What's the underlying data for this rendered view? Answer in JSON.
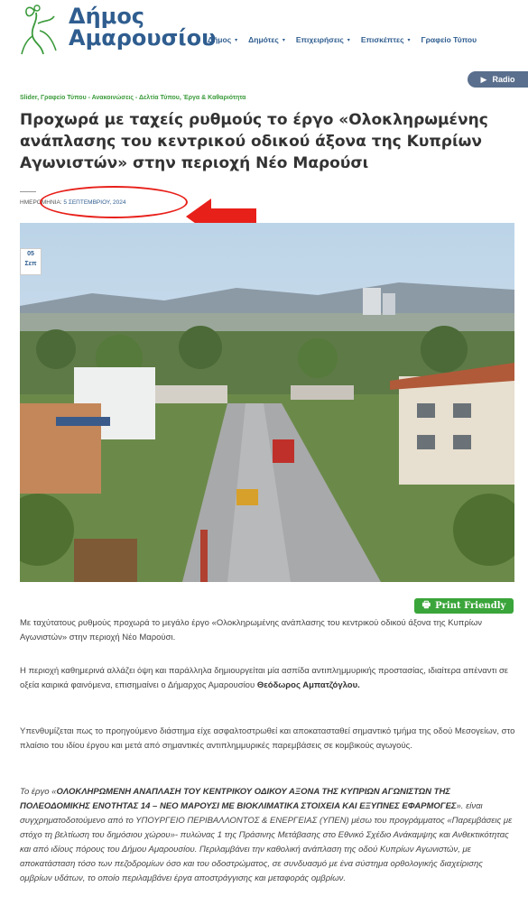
{
  "header": {
    "logo_line1": "Δήμος",
    "logo_line2": "Αμαρουσίου",
    "nav": [
      {
        "label": "Δήμος"
      },
      {
        "label": "Δημότες"
      },
      {
        "label": "Επιχειρήσεις"
      },
      {
        "label": "Επισκέπτες"
      },
      {
        "label": "Γραφείο Τύπου"
      }
    ],
    "radio_label": "Radio"
  },
  "article": {
    "categories": "Slider, Γραφείο Τύπου - Ανακοινώσεις - Δελτία Τύπου, Έργα & Καθαριότητα",
    "title": "Προχωρά με ταχείς ρυθμούς το έργο «Ολοκληρωμένης ανάπλασης του κεντρικού οδικού άξονα της Κυπρίων Αγωνιστών» στην περιοχή Νέο Μαρούσι",
    "date_label": "ΗΜΕΡΟΜΗΝΙΑ:",
    "date_value": "5 ΣΕΠΤΕΜΒΡΙΟΥ, 2024",
    "badge_day": "05",
    "badge_month": "Σεπ",
    "print_label": "Print Friendly",
    "p1": "Με ταχύτατους ρυθμούς προχωρά το μεγάλο έργο «Ολοκληρωμένης ανάπλασης του κεντρικού οδικού άξονα της Κυπρίων Αγωνιστών» στην περιοχή Νέο Μαρούσι.",
    "p2_text": "Η περιοχή καθημερινά αλλάζει όψη και παράλληλα δημιουργείται μία ασπίδα αντιπλημμυρικής προστασίας, ιδιαίτερα απέναντι σε οξεία καιρικά φαινόμενα, επισημαίνει ο Δήμαρχος Αμαρουσίου",
    "p2_bold": "Θεόδωρος Αμπατζόγλου.",
    "p3": "Υπενθυμίζεται πως το προηγούμενο διάστημα είχε ασφαλτοστρωθεί και αποκατασταθεί σημαντικό τμήμα της οδού Μεσογείων, στο πλαίσιο του ιδίου έργου και μετά από σημαντικές αντιπλημμυρικές παρεμβάσεις σε κομβικούς αγωγούς.",
    "p4_intro": "Το έργο «",
    "p4_bold": "ΟΛΟΚΛΗΡΩΜΕΝΗ ΑΝΑΠΛΑΣΗ ΤΟΥ ΚΕΝΤΡΙΚΟΥ ΟΔΙΚΟΥ ΑΞΟΝΑ ΤΗΣ ΚΥΠΡΙΩΝ ΑΓΩΝΙΣΤΩΝ ΤΗΣ ΠΟΛΕΟΔΟΜΙΚΗΣ ΕΝΟΤΗΤΑΣ 14 – ΝΕΟ ΜΑΡΟΥΣΙ ΜΕ ΒΙΟΚΛΙΜΑΤΙΚΑ ΣΤΟΙΧΕΙΑ ΚΑΙ ΕΞΥΠΝΕΣ ΕΦΑΡΜΟΓΕΣ",
    "p4_rest": "». είναι συγχρηματοδοτούμενο από το ΥΠΟΥΡΓΕΙΟ ΠΕΡΙΒΑΛΛΟΝΤΟΣ & ΕΝΕΡΓΕΙΑΣ (ΥΠΕΝ) μέσω του προγράμματος «Παρεμβάσεις με στόχο τη βελτίωση του δημόσιου χώρου»- πυλώνας 1 της Πράσινης Μετάβασης στο Εθνικό Σχέδιο Ανάκαμψης και Ανθεκτικότητας και από ιδίους πόρους του Δήμου Αμαρουσίου. Περιλαμβάνει την καθολική ανάπλαση της οδού Κυπρίων Αγωνιστών, με αποκατάσταση τόσο των πεζοδρομίων όσο και του οδοστρώματος, σε συνδυασμό με ένα σύστημα ορθολογικής διαχείρισης ομβρίων υδάτων, το οποίο περιλαμβάνει έργα αποστράγγισης και μεταφοράς ομβρίων."
  },
  "colors": {
    "brand_blue": "#2f5d8f",
    "category_green": "#3a9a3a",
    "annotation_red": "#e8201a",
    "print_green": "#3aa53a"
  }
}
